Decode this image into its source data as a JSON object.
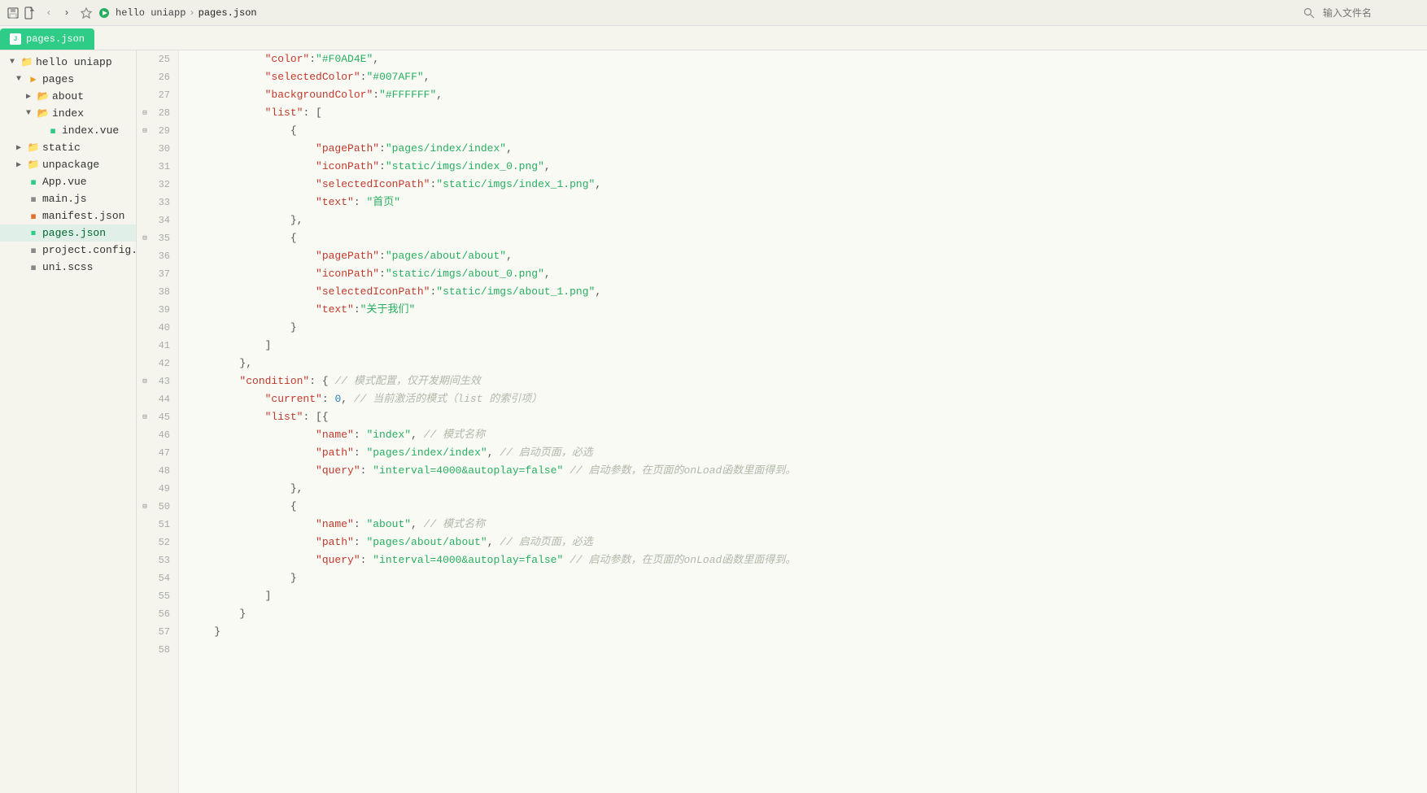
{
  "titlebar": {
    "icons": [
      "save-icon",
      "file-icon",
      "back-icon",
      "forward-icon",
      "star-icon",
      "run-icon"
    ],
    "breadcrumb": [
      "hello uniapp",
      "pages.json"
    ],
    "file_search_placeholder": "输入文件名"
  },
  "tab": {
    "label": "pages.json",
    "icon": "J"
  },
  "sidebar": {
    "root_label": "hello uniapp",
    "items": [
      {
        "id": "pages",
        "label": "pages",
        "type": "folder",
        "expanded": true,
        "indent": 1
      },
      {
        "id": "about",
        "label": "about",
        "type": "folder",
        "expanded": false,
        "indent": 2
      },
      {
        "id": "index",
        "label": "index",
        "type": "folder",
        "expanded": true,
        "indent": 2
      },
      {
        "id": "index_vue",
        "label": "index.vue",
        "type": "file-green",
        "indent": 3
      },
      {
        "id": "static",
        "label": "static",
        "type": "folder",
        "expanded": false,
        "indent": 1
      },
      {
        "id": "unpackage",
        "label": "unpackage",
        "type": "folder",
        "expanded": false,
        "indent": 1
      },
      {
        "id": "app_vue",
        "label": "App.vue",
        "type": "file-green",
        "indent": 1
      },
      {
        "id": "main_js",
        "label": "main.js",
        "type": "file-gray",
        "indent": 1
      },
      {
        "id": "manifest_json",
        "label": "manifest.json",
        "type": "file-orange",
        "indent": 1
      },
      {
        "id": "pages_json",
        "label": "pages.json",
        "type": "file-selected",
        "indent": 1
      },
      {
        "id": "project_config",
        "label": "project.config....",
        "type": "file-gray",
        "indent": 1
      },
      {
        "id": "uni_scss",
        "label": "uni.scss",
        "type": "file-gray",
        "indent": 1
      }
    ]
  },
  "editor": {
    "lines": [
      {
        "num": 25,
        "fold": false,
        "content": [
          {
            "type": "indent",
            "v": "            "
          },
          {
            "type": "key",
            "v": "\"color\""
          },
          {
            "type": "colon",
            "v": ":"
          },
          {
            "type": "string",
            "v": "\"#F0AD4E\""
          },
          {
            "type": "comma",
            "v": ","
          }
        ]
      },
      {
        "num": 26,
        "fold": false,
        "content": [
          {
            "type": "indent",
            "v": "            "
          },
          {
            "type": "key",
            "v": "\"selectedColor\""
          },
          {
            "type": "colon",
            "v": ":"
          },
          {
            "type": "string",
            "v": "\"#007AFF\""
          },
          {
            "type": "comma",
            "v": ","
          }
        ]
      },
      {
        "num": 27,
        "fold": false,
        "content": [
          {
            "type": "indent",
            "v": "            "
          },
          {
            "type": "key",
            "v": "\"backgroundColor\""
          },
          {
            "type": "colon",
            "v": ":"
          },
          {
            "type": "string",
            "v": "\"#FFFFFF\""
          },
          {
            "type": "comma",
            "v": ","
          }
        ]
      },
      {
        "num": 28,
        "fold": true,
        "content": [
          {
            "type": "indent",
            "v": "            "
          },
          {
            "type": "key",
            "v": "\"list\""
          },
          {
            "type": "colon",
            "v": ":"
          },
          {
            "type": "bracket",
            "v": "["
          }
        ]
      },
      {
        "num": 29,
        "fold": true,
        "content": [
          {
            "type": "indent",
            "v": "                "
          },
          {
            "type": "bracket",
            "v": "{"
          }
        ]
      },
      {
        "num": 30,
        "fold": false,
        "content": [
          {
            "type": "indent",
            "v": "                    "
          },
          {
            "type": "key",
            "v": "\"pagePath\""
          },
          {
            "type": "colon",
            "v": ":"
          },
          {
            "type": "string",
            "v": "\"pages/index/index\""
          },
          {
            "type": "comma",
            "v": ","
          }
        ]
      },
      {
        "num": 31,
        "fold": false,
        "content": [
          {
            "type": "indent",
            "v": "                    "
          },
          {
            "type": "key",
            "v": "\"iconPath\""
          },
          {
            "type": "colon",
            "v": ":"
          },
          {
            "type": "string",
            "v": "\"static/imgs/index_0.png\""
          },
          {
            "type": "comma",
            "v": ","
          }
        ]
      },
      {
        "num": 32,
        "fold": false,
        "content": [
          {
            "type": "indent",
            "v": "                    "
          },
          {
            "type": "key",
            "v": "\"selectedIconPath\""
          },
          {
            "type": "colon",
            "v": ":"
          },
          {
            "type": "string",
            "v": "\"static/imgs/index_1.png\""
          },
          {
            "type": "comma",
            "v": ","
          }
        ]
      },
      {
        "num": 33,
        "fold": false,
        "content": [
          {
            "type": "indent",
            "v": "                    "
          },
          {
            "type": "key",
            "v": "\"text\""
          },
          {
            "type": "colon",
            "v": ": "
          },
          {
            "type": "string",
            "v": "\"首页\""
          }
        ]
      },
      {
        "num": 34,
        "fold": false,
        "content": [
          {
            "type": "indent",
            "v": "                "
          },
          {
            "type": "bracket",
            "v": "},"
          }
        ]
      },
      {
        "num": 35,
        "fold": true,
        "content": [
          {
            "type": "indent",
            "v": "                "
          },
          {
            "type": "bracket",
            "v": "{"
          }
        ]
      },
      {
        "num": 36,
        "fold": false,
        "content": [
          {
            "type": "indent",
            "v": "                    "
          },
          {
            "type": "key",
            "v": "\"pagePath\""
          },
          {
            "type": "colon",
            "v": ":"
          },
          {
            "type": "string",
            "v": "\"pages/about/about\""
          },
          {
            "type": "comma",
            "v": ","
          }
        ]
      },
      {
        "num": 37,
        "fold": false,
        "content": [
          {
            "type": "indent",
            "v": "                    "
          },
          {
            "type": "key",
            "v": "\"iconPath\""
          },
          {
            "type": "colon",
            "v": ":"
          },
          {
            "type": "string",
            "v": "\"static/imgs/about_0.png\""
          },
          {
            "type": "comma",
            "v": ","
          }
        ]
      },
      {
        "num": 38,
        "fold": false,
        "content": [
          {
            "type": "indent",
            "v": "                    "
          },
          {
            "type": "key",
            "v": "\"selectedIconPath\""
          },
          {
            "type": "colon",
            "v": ":"
          },
          {
            "type": "string",
            "v": "\"static/imgs/about_1.png\""
          },
          {
            "type": "comma",
            "v": ","
          }
        ]
      },
      {
        "num": 39,
        "fold": false,
        "content": [
          {
            "type": "indent",
            "v": "                    "
          },
          {
            "type": "key",
            "v": "\"text\""
          },
          {
            "type": "colon",
            "v": ":"
          },
          {
            "type": "string",
            "v": "\"关于我们\""
          }
        ]
      },
      {
        "num": 40,
        "fold": false,
        "content": [
          {
            "type": "indent",
            "v": "                "
          },
          {
            "type": "bracket",
            "v": "}"
          }
        ]
      },
      {
        "num": 41,
        "fold": false,
        "content": [
          {
            "type": "indent",
            "v": "            "
          },
          {
            "type": "bracket",
            "v": "]"
          }
        ]
      },
      {
        "num": 42,
        "fold": false,
        "content": [
          {
            "type": "indent",
            "v": "        "
          },
          {
            "type": "bracket",
            "v": "},"
          }
        ]
      },
      {
        "num": 43,
        "fold": true,
        "content": [
          {
            "type": "indent",
            "v": "        "
          },
          {
            "type": "key",
            "v": "\"condition\""
          },
          {
            "type": "colon",
            "v": ": {"
          },
          {
            "type": "comment",
            "v": " // 模式配置，仅开发期间生效"
          }
        ]
      },
      {
        "num": 44,
        "fold": false,
        "content": [
          {
            "type": "indent",
            "v": "            "
          },
          {
            "type": "key",
            "v": "\"current\""
          },
          {
            "type": "colon",
            "v": ": "
          },
          {
            "type": "number",
            "v": "0"
          },
          {
            "type": "comma",
            "v": ","
          },
          {
            "type": "comment",
            "v": " // 当前激活的模式（list 的索引项）"
          }
        ]
      },
      {
        "num": 45,
        "fold": true,
        "content": [
          {
            "type": "indent",
            "v": "            "
          },
          {
            "type": "key",
            "v": "\"list\""
          },
          {
            "type": "colon",
            "v": ": [{"
          }
        ]
      },
      {
        "num": 46,
        "fold": false,
        "content": [
          {
            "type": "indent",
            "v": "                    "
          },
          {
            "type": "key",
            "v": "\"name\""
          },
          {
            "type": "colon",
            "v": ": "
          },
          {
            "type": "string",
            "v": "\"index\""
          },
          {
            "type": "comma",
            "v": ","
          },
          {
            "type": "comment",
            "v": " // 模式名称"
          }
        ]
      },
      {
        "num": 47,
        "fold": false,
        "content": [
          {
            "type": "indent",
            "v": "                    "
          },
          {
            "type": "key",
            "v": "\"path\""
          },
          {
            "type": "colon",
            "v": ": "
          },
          {
            "type": "string",
            "v": "\"pages/index/index\""
          },
          {
            "type": "comma",
            "v": ","
          },
          {
            "type": "comment",
            "v": " // 启动页面，必选"
          }
        ]
      },
      {
        "num": 48,
        "fold": false,
        "content": [
          {
            "type": "indent",
            "v": "                    "
          },
          {
            "type": "key",
            "v": "\"query\""
          },
          {
            "type": "colon",
            "v": ": "
          },
          {
            "type": "string",
            "v": "\"interval=4000&autoplay=false\""
          },
          {
            "type": "comment",
            "v": " // 启动参数，在页面的onLoad函数里面得到。"
          }
        ]
      },
      {
        "num": 49,
        "fold": false,
        "content": [
          {
            "type": "indent",
            "v": "                "
          },
          {
            "type": "bracket",
            "v": "},"
          }
        ]
      },
      {
        "num": 50,
        "fold": true,
        "content": [
          {
            "type": "indent",
            "v": "                "
          },
          {
            "type": "bracket",
            "v": "{"
          }
        ]
      },
      {
        "num": 51,
        "fold": false,
        "content": [
          {
            "type": "indent",
            "v": "                    "
          },
          {
            "type": "key",
            "v": "\"name\""
          },
          {
            "type": "colon",
            "v": ": "
          },
          {
            "type": "string",
            "v": "\"about\""
          },
          {
            "type": "comma",
            "v": ","
          },
          {
            "type": "comment",
            "v": " // 模式名称"
          }
        ]
      },
      {
        "num": 52,
        "fold": false,
        "content": [
          {
            "type": "indent",
            "v": "                    "
          },
          {
            "type": "key",
            "v": "\"path\""
          },
          {
            "type": "colon",
            "v": ": "
          },
          {
            "type": "string",
            "v": "\"pages/about/about\""
          },
          {
            "type": "comma",
            "v": ","
          },
          {
            "type": "comment",
            "v": " // 启动页面，必选"
          }
        ]
      },
      {
        "num": 53,
        "fold": false,
        "content": [
          {
            "type": "indent",
            "v": "                    "
          },
          {
            "type": "key",
            "v": "\"query\""
          },
          {
            "type": "colon",
            "v": ": "
          },
          {
            "type": "string",
            "v": "\"interval=4000&autoplay=false\""
          },
          {
            "type": "comment",
            "v": " // 启动参数，在页面的onLoad函数里面得到。"
          }
        ]
      },
      {
        "num": 54,
        "fold": false,
        "content": [
          {
            "type": "indent",
            "v": "                "
          },
          {
            "type": "bracket",
            "v": "}"
          }
        ]
      },
      {
        "num": 55,
        "fold": false,
        "content": [
          {
            "type": "indent",
            "v": "            "
          },
          {
            "type": "bracket",
            "v": "]"
          }
        ]
      },
      {
        "num": 56,
        "fold": false,
        "content": [
          {
            "type": "indent",
            "v": "        "
          },
          {
            "type": "bracket",
            "v": "}"
          }
        ]
      },
      {
        "num": 57,
        "fold": false,
        "content": [
          {
            "type": "indent",
            "v": "    "
          },
          {
            "type": "bracket",
            "v": "}"
          }
        ]
      },
      {
        "num": 58,
        "fold": false,
        "content": []
      }
    ]
  }
}
